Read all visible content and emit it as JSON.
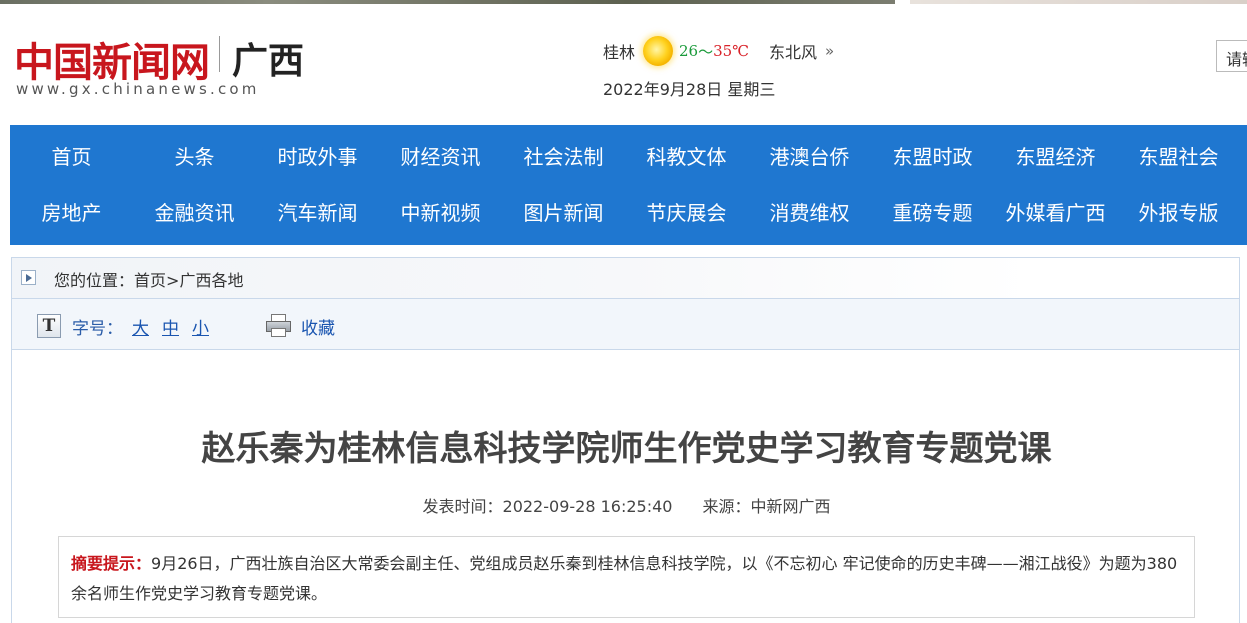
{
  "header": {
    "logo_cn": "中国新闻网",
    "logo_region": "广西",
    "logo_url": "www.gx.chinanews.com",
    "weather": {
      "city": "桂林",
      "icon": "sun-icon",
      "temp_low": "26",
      "temp_sep": "～",
      "temp_high": "35℃",
      "wind": "东北风",
      "more": "»"
    },
    "date": "2022年9月28日 星期三",
    "search_text": "请输"
  },
  "nav": {
    "row1": [
      "首页",
      "头条",
      "时政外事",
      "财经资讯",
      "社会法制",
      "科教文体",
      "港澳台侨",
      "东盟时政",
      "东盟经济",
      "东盟社会"
    ],
    "row2": [
      "房地产",
      "金融资讯",
      "汽车新闻",
      "中新视频",
      "图片新闻",
      "节庆展会",
      "消费维权",
      "重磅专题",
      "外媒看广西",
      "外报专版"
    ]
  },
  "breadcrumb": {
    "prefix": "您的位置：",
    "home": "首页",
    "sep": ">",
    "current": "广西各地"
  },
  "toolbar": {
    "font_icon": "T",
    "size_label": "字号：",
    "size_large": "大",
    "size_medium": "中",
    "size_small": "小",
    "favorite": "收藏"
  },
  "article": {
    "title": "赵乐秦为桂林信息科技学院师生作党史学习教育专题党课",
    "publish_time": "发表时间：2022-09-28 16:25:40",
    "source": "来源：中新网广西",
    "summary_label": "摘要提示：",
    "summary_text": "9月26日，广西壮族自治区大常委会副主任、党组成员赵乐秦到桂林信息科技学院，以《不忘初心 牢记使命的历史丰碑——湘江战役》为题为380余名师生作党史学习教育专题党课。"
  },
  "colors": {
    "nav_bg": "#1f77d0",
    "logo_red": "#c8161d",
    "link_blue": "#1a55b0"
  }
}
